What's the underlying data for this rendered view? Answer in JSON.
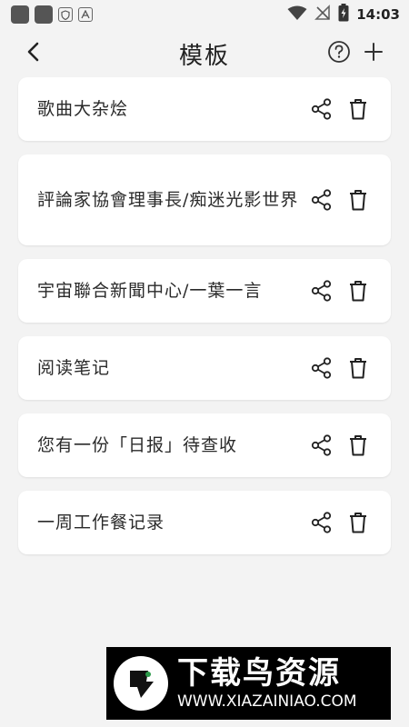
{
  "status_bar": {
    "time": "14:03",
    "icons": [
      "app-square-icon",
      "app-square-icon",
      "shield-icon",
      "font-icon",
      "wifi-icon",
      "signal-off-icon",
      "battery-charging-icon"
    ]
  },
  "header": {
    "title": "模板",
    "icons": [
      "back-arrow-icon",
      "help-circle-icon",
      "plus-icon"
    ]
  },
  "templates": [
    {
      "title": "歌曲大杂烩"
    },
    {
      "title": "評論家協會理事長/痴迷光影世界"
    },
    {
      "title": "宇宙聯合新聞中心/一葉一言"
    },
    {
      "title": "阅读笔记"
    },
    {
      "title": "您有一份「日报」待查收"
    },
    {
      "title": "一周工作餐记录"
    }
  ],
  "item_icons": [
    "share-icon",
    "trash-icon"
  ],
  "watermark": {
    "title": "下载鸟资源",
    "url": "WWW.XIAZAINIAO.COM"
  },
  "colors": {
    "background": "#f3f3f3",
    "card": "#ffffff",
    "text": "#222222"
  }
}
